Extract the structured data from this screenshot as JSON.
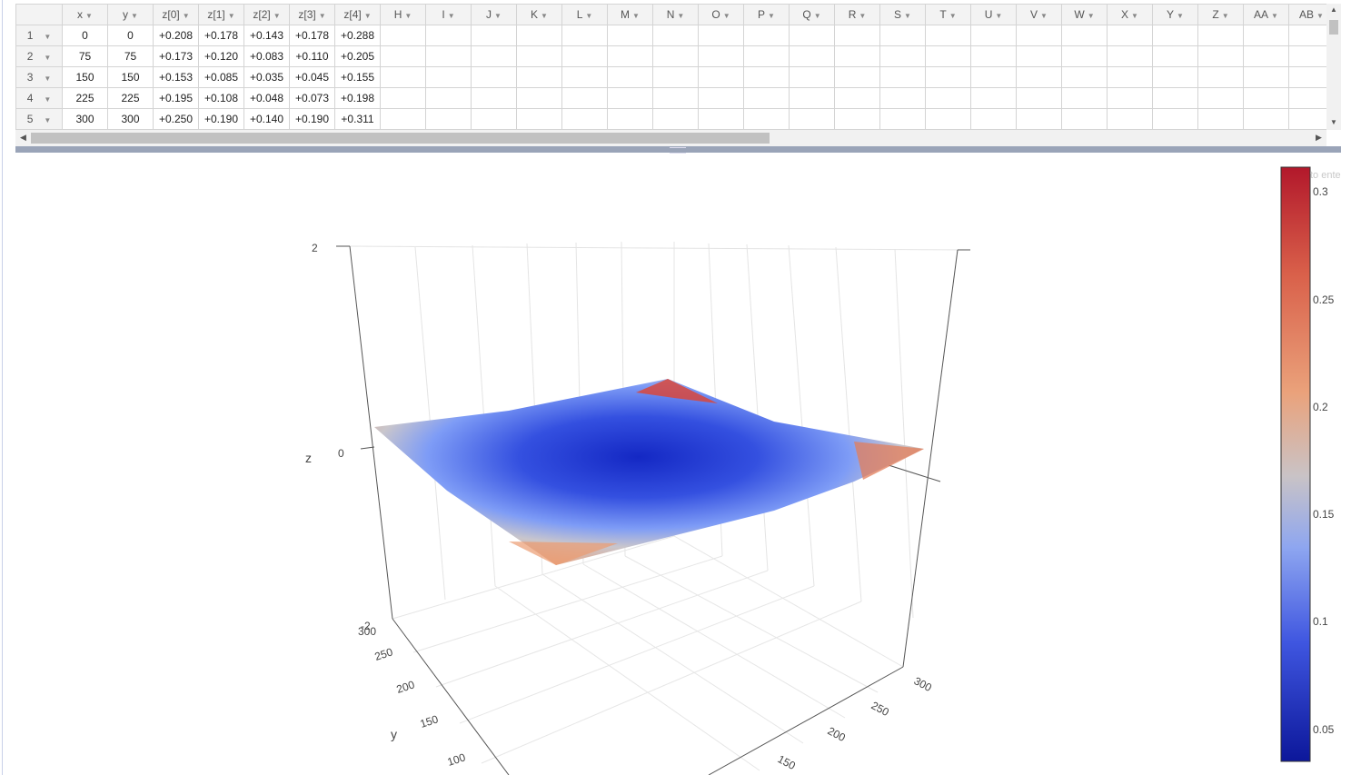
{
  "spreadsheet": {
    "columns": [
      "x",
      "y",
      "z[0]",
      "z[1]",
      "z[2]",
      "z[3]",
      "z[4]",
      "H",
      "I",
      "J",
      "K",
      "L",
      "M",
      "N",
      "O",
      "P",
      "Q",
      "R",
      "S",
      "T",
      "U",
      "V",
      "W",
      "X",
      "Y",
      "Z",
      "AA",
      "AB"
    ],
    "rows": [
      {
        "index": "1",
        "cells": [
          "0",
          "0",
          "+0.208",
          "+0.178",
          "+0.143",
          "+0.178",
          "+0.288"
        ]
      },
      {
        "index": "2",
        "cells": [
          "75",
          "75",
          "+0.173",
          "+0.120",
          "+0.083",
          "+0.110",
          "+0.205"
        ]
      },
      {
        "index": "3",
        "cells": [
          "150",
          "150",
          "+0.153",
          "+0.085",
          "+0.035",
          "+0.045",
          "+0.155"
        ]
      },
      {
        "index": "4",
        "cells": [
          "225",
          "225",
          "+0.195",
          "+0.108",
          "+0.048",
          "+0.073",
          "+0.198"
        ]
      },
      {
        "index": "5",
        "cells": [
          "300",
          "300",
          "+0.250",
          "+0.190",
          "+0.140",
          "+0.190",
          "+0.311"
        ]
      }
    ]
  },
  "plot": {
    "z_axis_label": "z",
    "y_axis_label": "y",
    "z_ticks": [
      "2",
      "0",
      "-2"
    ],
    "y_ticks": [
      "300",
      "250",
      "200",
      "150",
      "100"
    ],
    "x_ticks": [
      "300",
      "250",
      "200",
      "150"
    ],
    "colorbar": {
      "ticks": [
        "0.3",
        "0.25",
        "0.2",
        "0.15",
        "0.1",
        "0.05"
      ],
      "colors": [
        "#b2182b",
        "#e3885e",
        "#c8c8c8",
        "#7b9cf8",
        "#2a3bd8",
        "#0a1a9e"
      ]
    },
    "hint_text": "to ente"
  },
  "chart_data": {
    "type": "surface",
    "x": [
      0,
      75,
      150,
      225,
      300
    ],
    "y": [
      0,
      75,
      150,
      225,
      300
    ],
    "z": [
      [
        0.208,
        0.178,
        0.143,
        0.178,
        0.288
      ],
      [
        0.173,
        0.12,
        0.083,
        0.11,
        0.205
      ],
      [
        0.153,
        0.085,
        0.035,
        0.045,
        0.155
      ],
      [
        0.195,
        0.108,
        0.048,
        0.073,
        0.198
      ],
      [
        0.25,
        0.19,
        0.14,
        0.19,
        0.311
      ]
    ],
    "zlim": [
      -2,
      2
    ],
    "colorscale": "coolwarm",
    "colorbar_range": [
      0.035,
      0.311
    ],
    "grid": true
  }
}
